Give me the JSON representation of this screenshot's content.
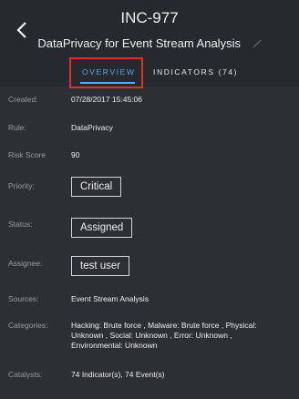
{
  "header": {
    "incident_id": "INC-977",
    "title": "DataPrivacy for Event Stream Analysis"
  },
  "tabs": [
    {
      "label": "OVERVIEW",
      "active": true
    },
    {
      "label": "INDICATORS (74)",
      "active": false
    }
  ],
  "fields": {
    "created": {
      "label": "Created:",
      "value": "07/28/2017 15:45:06"
    },
    "rule": {
      "label": "Rule:",
      "value": "DataPrivacy"
    },
    "risk": {
      "label": "Risk Score",
      "value": "90"
    },
    "priority": {
      "label": "Priority:",
      "value": "Critical"
    },
    "status": {
      "label": "Status:",
      "value": "Assigned"
    },
    "assignee": {
      "label": "Assignee:",
      "value": "test user"
    },
    "sources": {
      "label": "Sources:",
      "value": "Event Stream Analysis"
    },
    "categories": {
      "label": "Categories:",
      "line1": "Hacking: Brute force , Malware: Brute force , Physical:",
      "line2": "Unknown , Social: Unknown , Error: Unknown ,",
      "line3": "Environmental: Unknown"
    },
    "catalysts": {
      "label": "Catalysts:",
      "value": "74 Indicator(s), 74 Event(s)"
    }
  },
  "colors": {
    "accent": "#5aa9f2",
    "highlight_border": "#d9342b",
    "background": "#2c2f33"
  },
  "icons": {
    "back": "chevron-left-icon",
    "edit": "pencil-icon"
  }
}
